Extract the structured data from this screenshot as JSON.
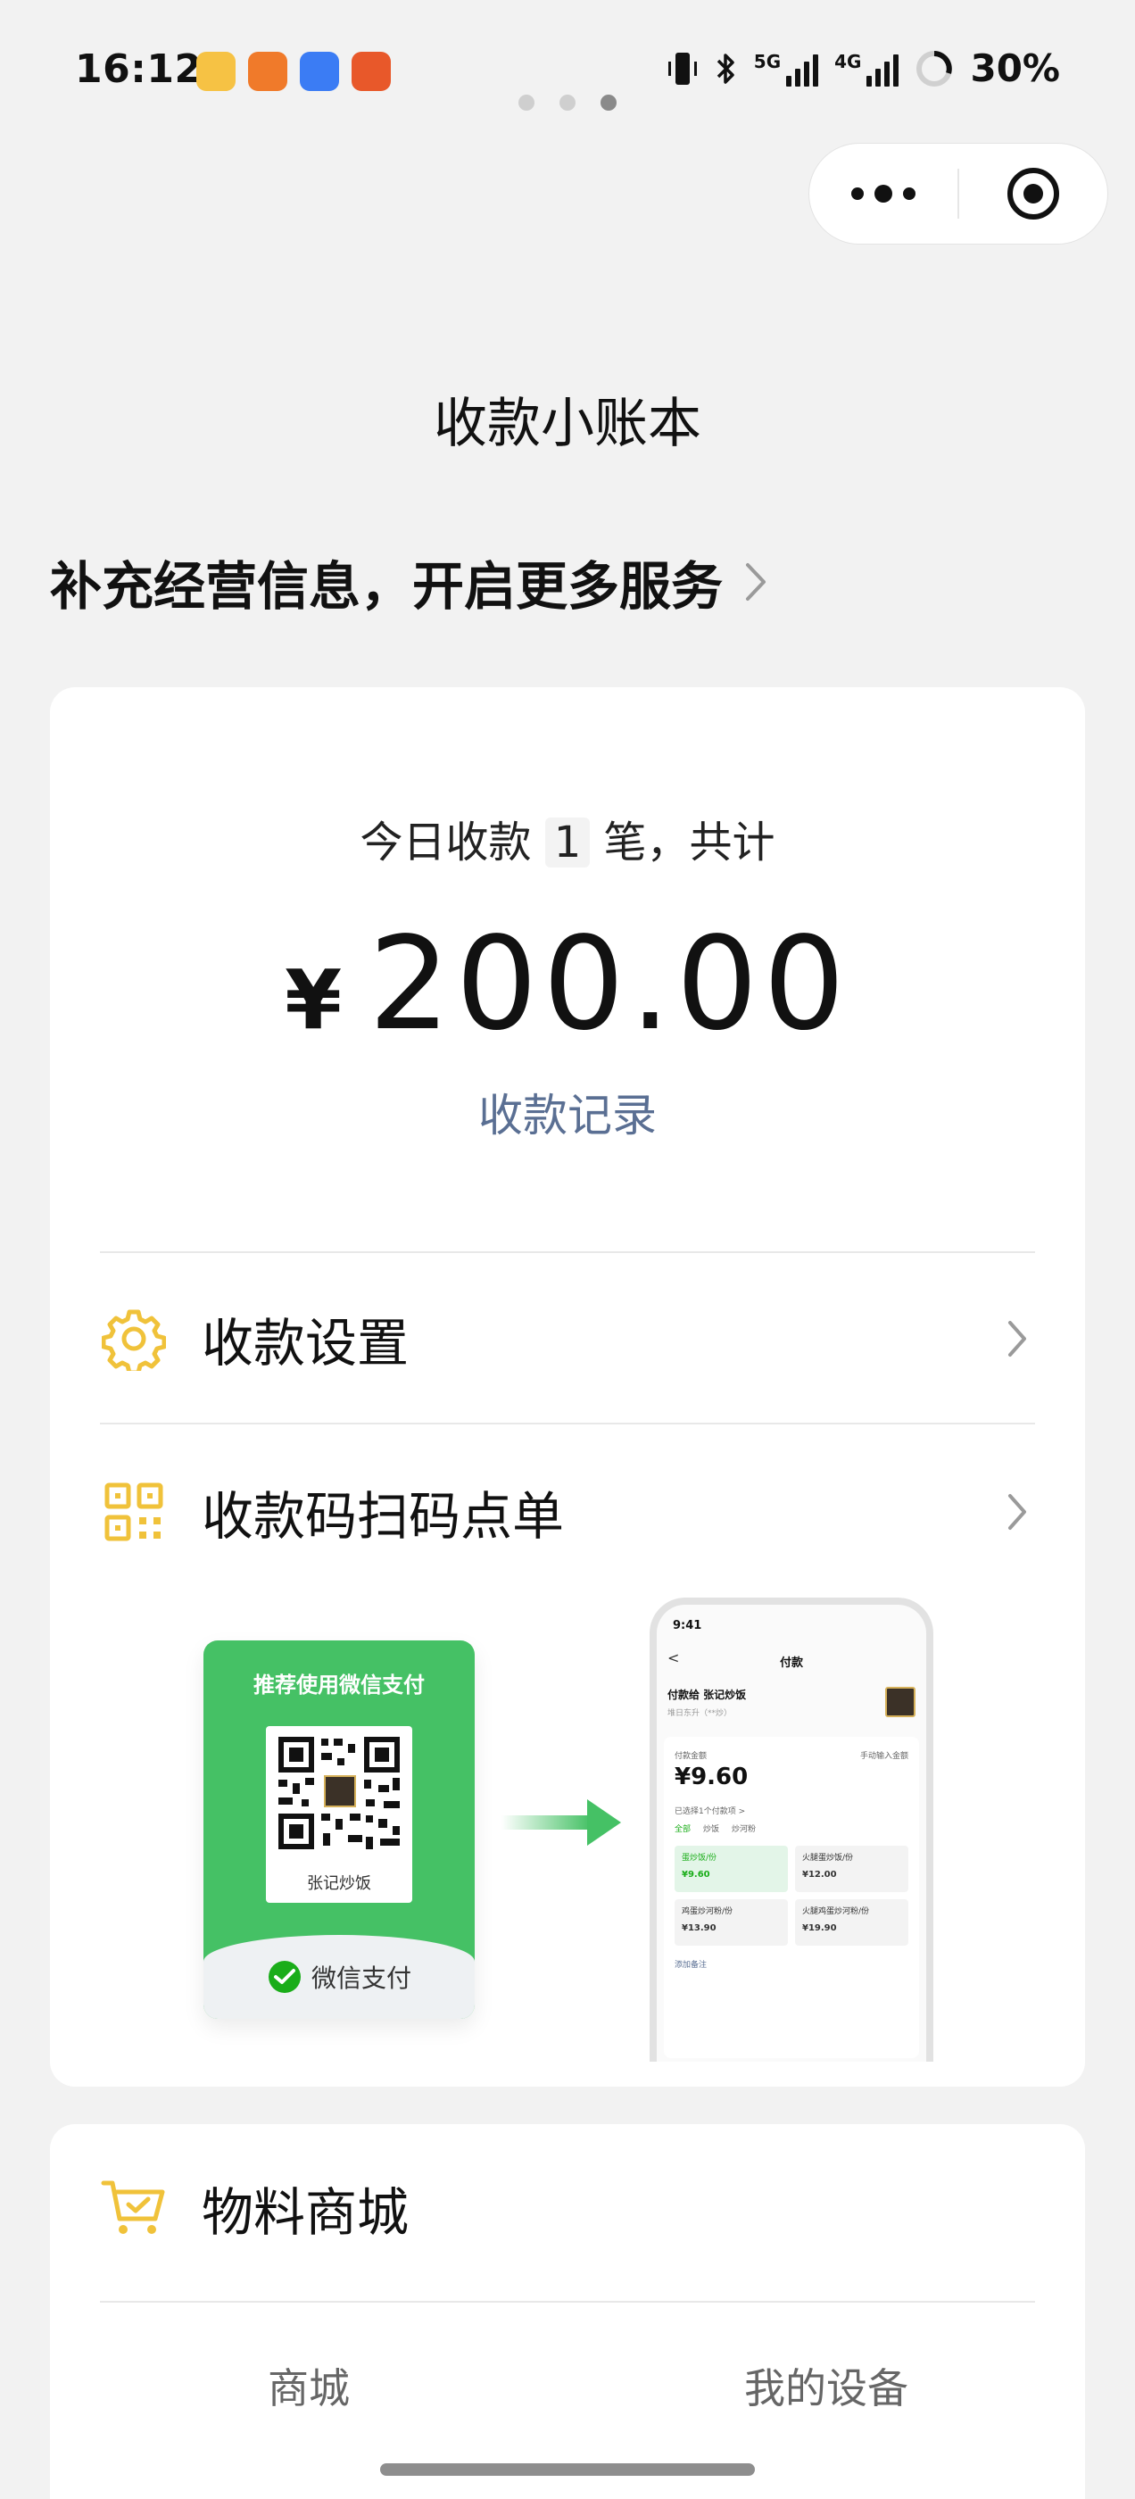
{
  "status_bar": {
    "time": "16:12",
    "net_5g": "5G",
    "net_4g": "4G",
    "battery": "30%"
  },
  "page": {
    "title": "收款小账本",
    "biz_link": "补充经营信息，开启更多服务"
  },
  "summary": {
    "today_prefix": "今日收款",
    "today_count": "1",
    "today_suffix": "笔，共计",
    "currency": "¥",
    "amount": "200.00",
    "records_link": "收款记录"
  },
  "menu": {
    "settings": "收款设置",
    "scan_order": "收款码扫码点单"
  },
  "illustration": {
    "qr_header": "推荐使用微信支付",
    "qr_shop_name": "张记炒饭",
    "qr_footer": "微信支付",
    "phone_time": "9:41",
    "phone_title": "付款",
    "phone_back": "<",
    "phone_payee": "付款给 张记炒饭",
    "phone_payee_sub": "堆日东升（**炒）",
    "phone_amount_label": "付款金额",
    "phone_manual": "手动输入金额",
    "phone_amount": "¥9.60",
    "phone_selected": "已选择1个付款项 >",
    "phone_tabs": [
      "全部",
      "炒饭",
      "炒河粉"
    ],
    "phone_items": [
      {
        "name": "蛋炒饭/份",
        "price": "¥9.60"
      },
      {
        "name": "火腿蛋炒饭/份",
        "price": "¥12.00"
      },
      {
        "name": "鸡蛋炒河粉/份",
        "price": "¥13.90"
      },
      {
        "name": "火腿鸡蛋炒河粉/份",
        "price": "¥19.90"
      }
    ],
    "phone_note": "添加备注"
  },
  "shop": {
    "title": "物料商城",
    "tab_mall": "商城",
    "tab_devices": "我的设备"
  },
  "colors": {
    "accent_link": "#5a6f93",
    "icon_yellow": "#f0c23a",
    "wechat_green": "#45c165"
  }
}
